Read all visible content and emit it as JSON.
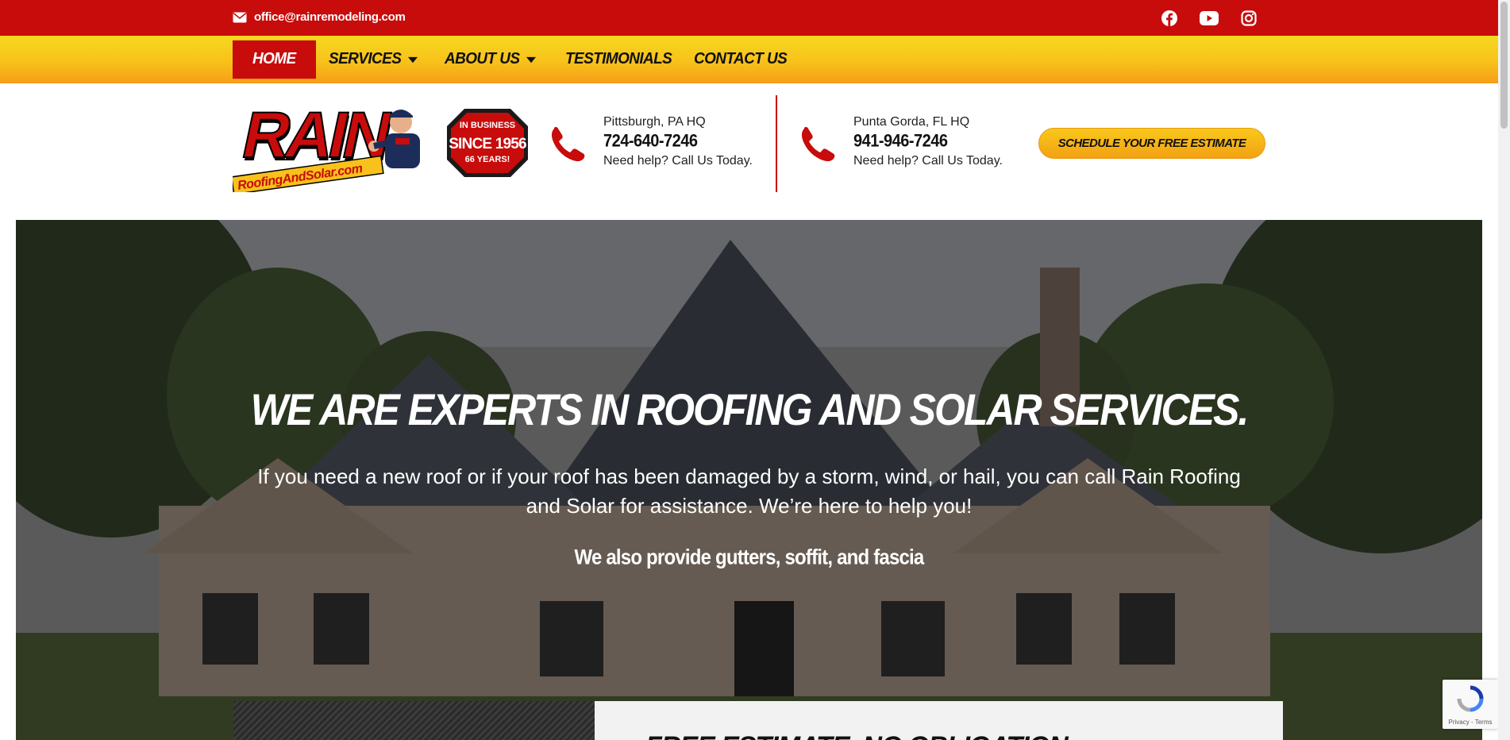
{
  "topbar": {
    "email": "office@rainremodeling.com",
    "social": [
      "facebook-icon",
      "youtube-icon",
      "instagram-icon"
    ]
  },
  "nav": {
    "items": [
      {
        "label": "HOME",
        "active": true
      },
      {
        "label": "SERVICES",
        "dropdown": true
      },
      {
        "label": "ABOUT US",
        "dropdown": true
      },
      {
        "label": "TESTIMONIALS"
      },
      {
        "label": "CONTACT US"
      }
    ]
  },
  "logo": {
    "brand": "RAIN",
    "domain": "RoofingAndSolar.com"
  },
  "badge": {
    "line1": "IN BUSINESS",
    "line2": "SINCE 1956",
    "line3": "66 YEARS!"
  },
  "contacts": [
    {
      "hq": "Pittsburgh, PA HQ",
      "phone": "724-640-7246",
      "help": "Need help? Call Us Today."
    },
    {
      "hq": "Punta Gorda, FL HQ",
      "phone": "941-946-7246",
      "help": "Need help? Call Us Today."
    }
  ],
  "cta": {
    "label": "SCHEDULE YOUR FREE ESTIMATE"
  },
  "hero": {
    "title": "WE ARE EXPERTS IN ROOFING AND SOLAR SERVICES.",
    "text": "If you need a new roof or if your roof has been damaged by a storm, wind, or hail, you can call Rain Roofing and Solar for assistance. We’re here to help you!",
    "subtitle": "We also provide gutters, soffit, and fascia"
  },
  "estimate": {
    "heading": "FREE ESTIMATE. NO OBLIGATION."
  },
  "recaptcha": {
    "label": "Privacy - Terms"
  },
  "colors": {
    "brand_red": "#c80b0b",
    "nav_yellow": "#f8c11b",
    "cta_orange": "#f3a114"
  }
}
